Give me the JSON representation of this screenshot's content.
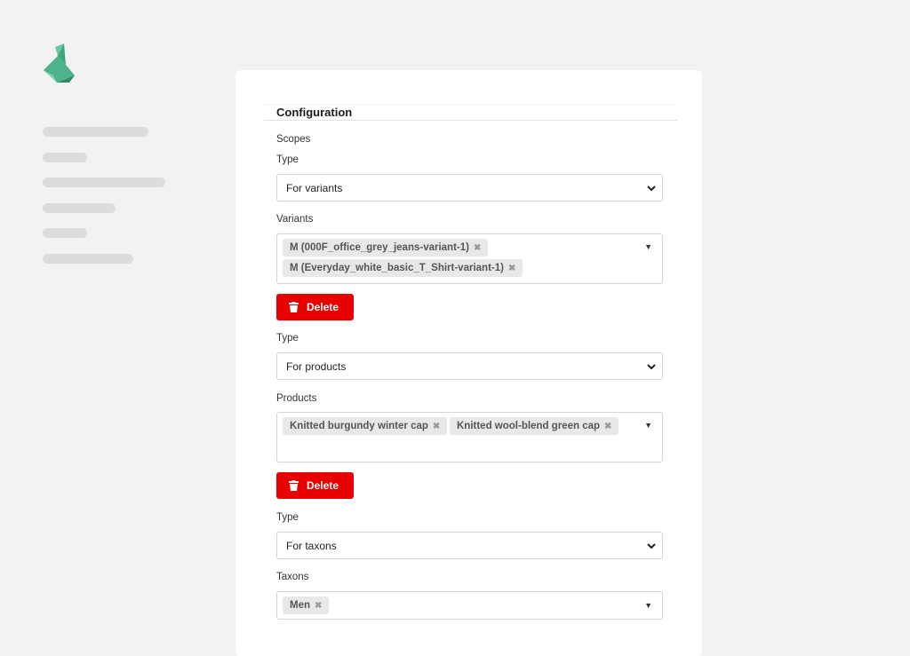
{
  "brand": {
    "accent": "#4cb38a",
    "danger": "#e80000"
  },
  "icons": [
    "swan-logo-icon",
    "trash-icon",
    "chevron-down-icon",
    "caret-down-icon",
    "close-icon"
  ],
  "configuration": {
    "title": "Configuration",
    "scopes_label": "Scopes",
    "blocks": [
      {
        "type_label": "Type",
        "type_value": "For variants",
        "items_label": "Variants",
        "chips": [
          "M (000F_office_grey_jeans-variant-1)",
          "M (Everyday_white_basic_T_Shirt-variant-1)"
        ],
        "remove_glyph": "✖",
        "delete_label": "Delete"
      },
      {
        "type_label": "Type",
        "type_value": "For products",
        "items_label": "Products",
        "chips": [
          "Knitted burgundy winter cap",
          "Knitted wool-blend green cap"
        ],
        "remove_glyph": "✖",
        "delete_label": "Delete"
      },
      {
        "type_label": "Type",
        "type_value": "For taxons",
        "items_label": "Taxons",
        "chips": [
          "Men"
        ],
        "remove_glyph": "✖"
      }
    ]
  }
}
